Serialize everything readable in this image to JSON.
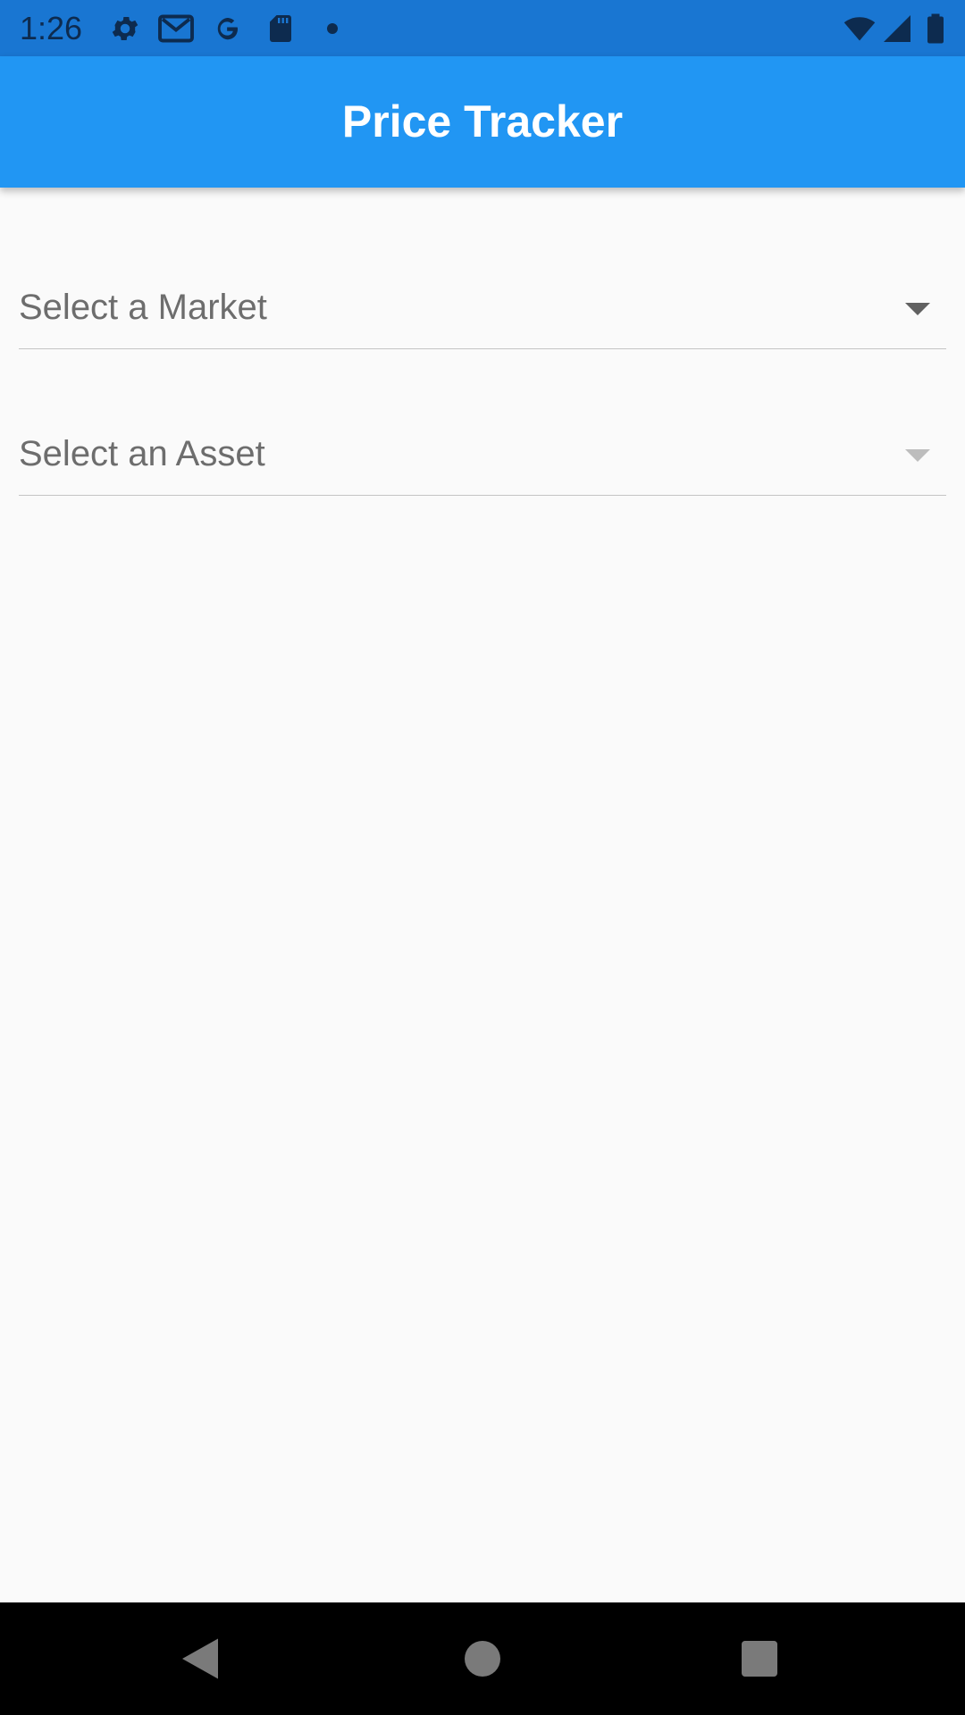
{
  "status_bar": {
    "time": "1:26",
    "icons": [
      "settings-icon",
      "gmail-icon",
      "google-icon",
      "sd-card-icon",
      "notification-dot-icon",
      "wifi-icon",
      "cell-signal-icon",
      "battery-icon"
    ]
  },
  "app_bar": {
    "title": "Price Tracker"
  },
  "form": {
    "market_dropdown": {
      "label": "Select a Market",
      "icon": "dropdown-arrow-icon"
    },
    "asset_dropdown": {
      "label": "Select an Asset",
      "icon": "dropdown-arrow-icon"
    }
  },
  "nav_bar": {
    "icons": [
      "back-icon",
      "home-icon",
      "recents-icon"
    ]
  },
  "colors": {
    "status_bar": "#1976d2",
    "app_bar": "#2196f3",
    "background": "#fafafa",
    "label_text": "#6d6d6d"
  }
}
